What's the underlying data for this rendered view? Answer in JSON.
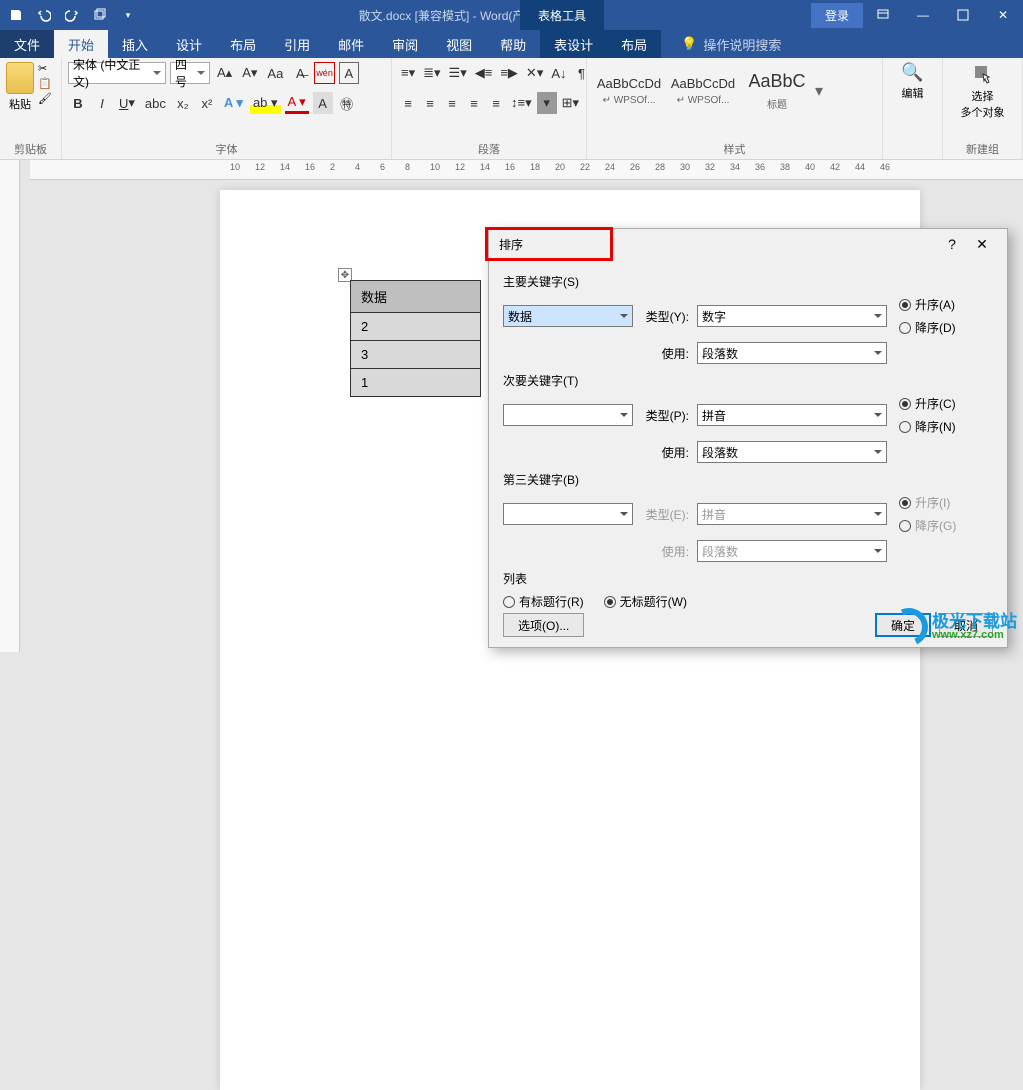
{
  "titlebar": {
    "doc_title": "散文.docx [兼容模式] - Word(产品激活失败)",
    "context_tab": "表格工具",
    "login": "登录"
  },
  "tabs": {
    "file": "文件",
    "home": "开始",
    "insert": "插入",
    "design": "设计",
    "layout": "布局",
    "references": "引用",
    "mailings": "邮件",
    "review": "审阅",
    "view": "视图",
    "help": "帮助",
    "table_design": "表设计",
    "table_layout": "布局",
    "tell_me": "操作说明搜索"
  },
  "ribbon": {
    "clipboard": {
      "label": "剪贴板",
      "paste": "粘贴"
    },
    "font": {
      "label": "字体",
      "name": "宋体 (中文正文)",
      "size": "四号",
      "wen": "wén"
    },
    "paragraph": {
      "label": "段落"
    },
    "styles": {
      "label": "样式",
      "items": [
        {
          "preview": "AaBbCcDd",
          "name": "↵ WPSOf..."
        },
        {
          "preview": "AaBbCcDd",
          "name": "↵ WPSOf..."
        },
        {
          "preview": "AaBbC",
          "name": "标题"
        }
      ]
    },
    "editing": {
      "label": "编辑"
    },
    "new_group": {
      "select_multi": "选择\n多个对象",
      "label": "新建组"
    }
  },
  "ruler": {
    "marks": [
      "10",
      "12",
      "14",
      "16",
      "2",
      "4",
      "6",
      "8",
      "10",
      "12",
      "14",
      "16",
      "18",
      "20",
      "22",
      "24",
      "26",
      "28",
      "30",
      "32",
      "34",
      "36",
      "38",
      "40",
      "42",
      "44",
      "46"
    ]
  },
  "doc_table": {
    "header": "数据",
    "rows": [
      "2",
      "3",
      "1"
    ]
  },
  "dialog": {
    "title": "排序",
    "primary_key": "主要关键字(S)",
    "secondary_key": "次要关键字(T)",
    "third_key": "第三关键字(B)",
    "type_label": "类型",
    "type_y": "类型(Y):",
    "type_p": "类型(P):",
    "type_e": "类型(E):",
    "use_label": "使用:",
    "primary_value": "数据",
    "type_number": "数字",
    "type_pinyin": "拼音",
    "use_paragraph": "段落数",
    "asc_a": "升序(A)",
    "desc_d": "降序(D)",
    "asc_c": "升序(C)",
    "desc_n": "降序(N)",
    "asc_i": "升序(I)",
    "desc_g": "降序(G)",
    "list_label": "列表",
    "has_header": "有标题行(R)",
    "no_header": "无标题行(W)",
    "options": "选项(O)...",
    "ok": "确定",
    "cancel": "取消"
  },
  "watermark": {
    "brand": "极光下载站",
    "url": "www.xz7.com"
  }
}
